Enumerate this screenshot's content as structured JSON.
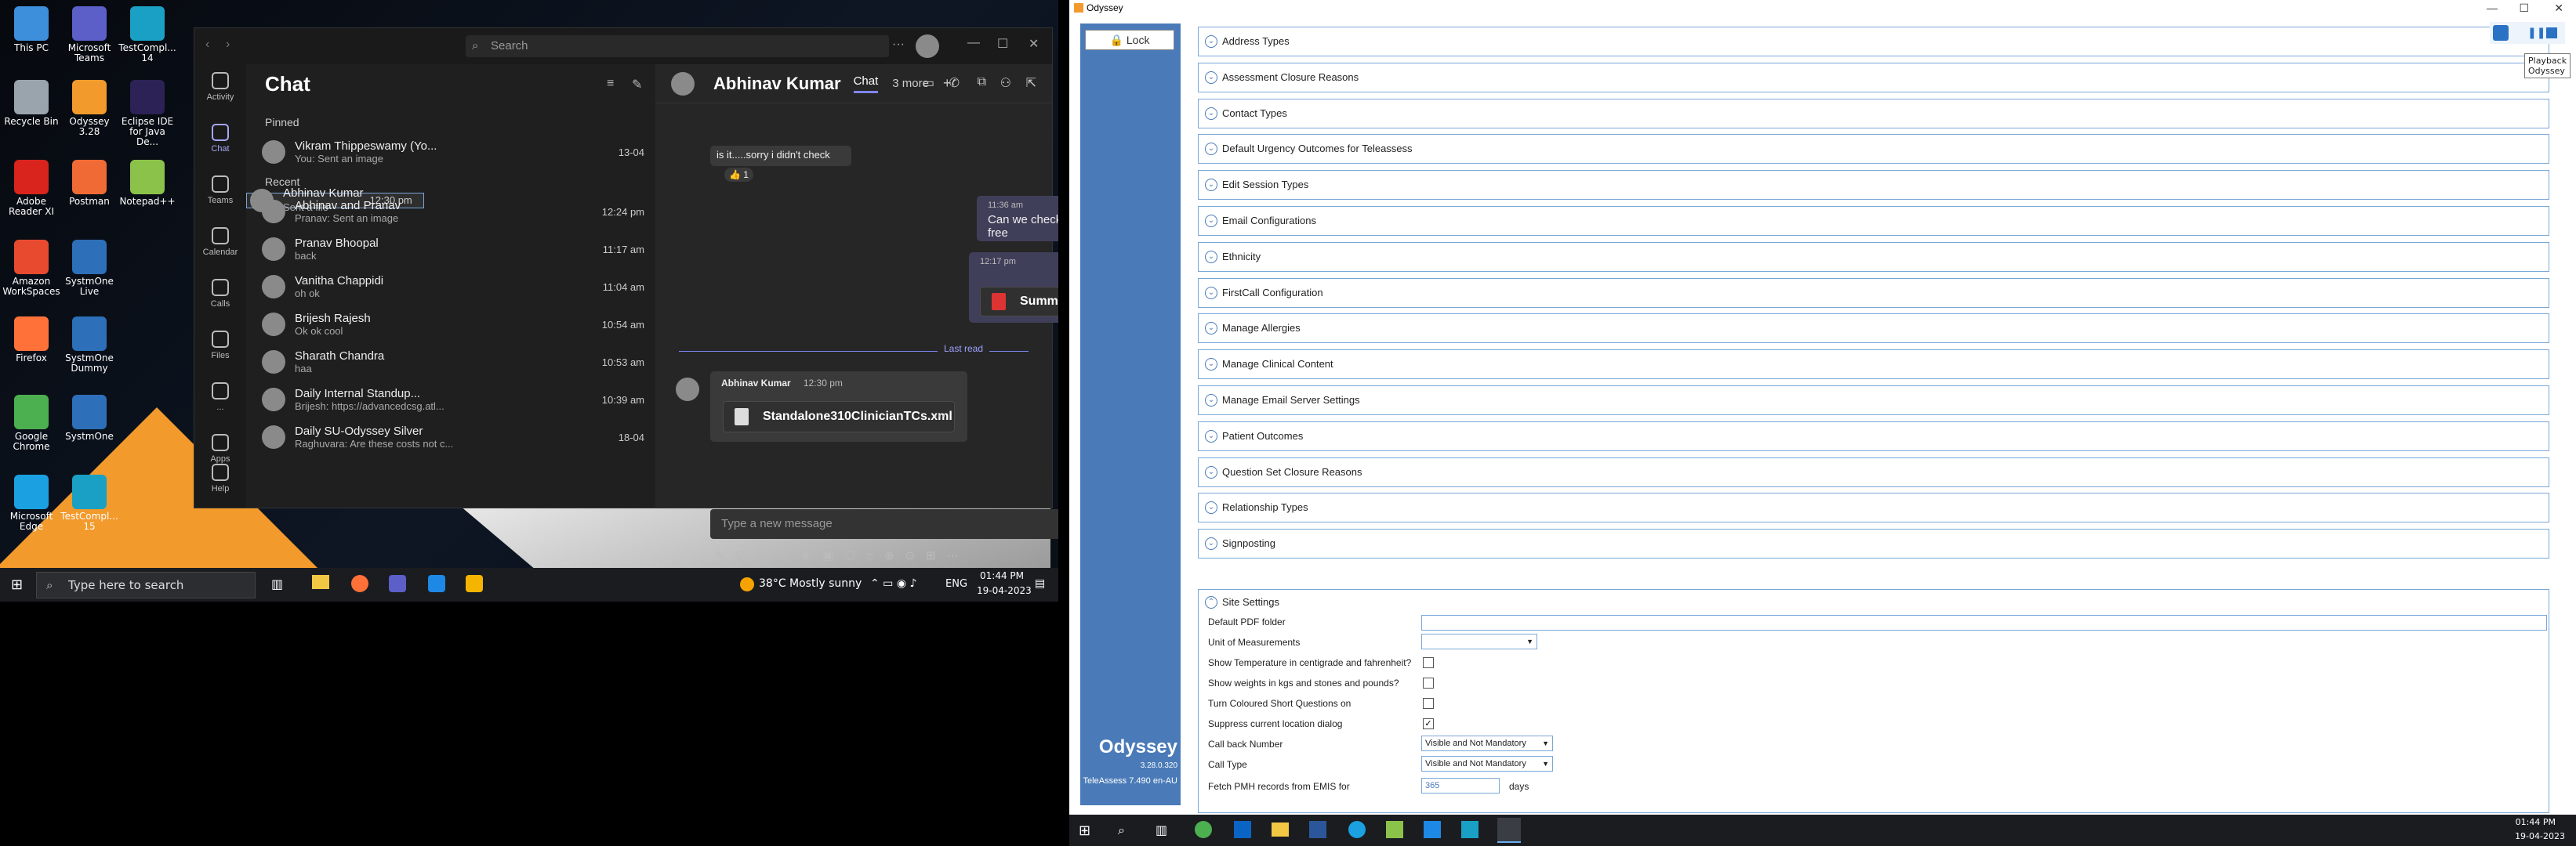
{
  "desktop": {
    "icons": [
      {
        "label": "This PC",
        "color": "#3d8edb"
      },
      {
        "label": "Microsoft Teams",
        "color": "#5b5fc7"
      },
      {
        "label": "TestCompl... 14",
        "color": "#1aa0c4"
      },
      {
        "label": "Recycle Bin",
        "color": "#9aa4ad"
      },
      {
        "label": "Odyssey 3.28",
        "color": "#f29a2c"
      },
      {
        "label": "Eclipse IDE for Java De...",
        "color": "#2c2255"
      },
      {
        "label": "Adobe Reader XI",
        "color": "#d8241c"
      },
      {
        "label": "Postman",
        "color": "#f06a35"
      },
      {
        "label": "Notepad++",
        "color": "#8bc34a"
      },
      {
        "label": "Amazon WorkSpaces",
        "color": "#e84a2f"
      },
      {
        "label": "SystmOne Live",
        "color": "#2d6fb8"
      },
      {
        "label": "Firefox",
        "color": "#ff7139"
      },
      {
        "label": "SystmOne Dummy",
        "color": "#2d6fb8"
      },
      {
        "label": "Google Chrome",
        "color": "#4caf50"
      },
      {
        "label": "SystmOne",
        "color": "#2d6fb8"
      },
      {
        "label": "Microsoft Edge",
        "color": "#1ba1e2"
      },
      {
        "label": "TestCompl... 15",
        "color": "#1aa0c4"
      }
    ]
  },
  "teams": {
    "search_placeholder": "Search",
    "rail": [
      {
        "label": "Activity"
      },
      {
        "label": "Chat"
      },
      {
        "label": "Teams"
      },
      {
        "label": "Calendar"
      },
      {
        "label": "Calls"
      },
      {
        "label": "Files"
      },
      {
        "label": "..."
      },
      {
        "label": "Apps"
      },
      {
        "label": "Help"
      }
    ],
    "list_title": "Chat",
    "pinned_label": "Pinned",
    "recent_label": "Recent",
    "pinned": [
      {
        "name": "Vikram Thippeswamy (Yo...",
        "preview": "You: Sent an image",
        "time": "13-04"
      }
    ],
    "recent": [
      {
        "name": "Abhinav Kumar",
        "preview": "Sent a file",
        "time": "12:30 pm"
      },
      {
        "name": "Abhinav and Pranav",
        "preview": "Pranav: Sent an image",
        "time": "12:24 pm"
      },
      {
        "name": "Pranav Bhoopal",
        "preview": "back",
        "time": "11:17 am"
      },
      {
        "name": "Vanitha Chappidi",
        "preview": "oh ok",
        "time": "11:04 am"
      },
      {
        "name": "Brijesh Rajesh",
        "preview": "Ok ok cool",
        "time": "10:54 am"
      },
      {
        "name": "Sharath Chandra",
        "preview": "haa",
        "time": "10:53 am"
      },
      {
        "name": "Daily Internal Standup...",
        "preview": "Brijesh: https://advancedcsg.atl...",
        "time": "10:39 am"
      },
      {
        "name": "Daily SU-Odyssey Silver",
        "preview": "Raghuvara: Are these costs not c...",
        "time": "18-04"
      }
    ],
    "header": {
      "name": "Abhinav Kumar",
      "tab_chat": "Chat",
      "tab_more": "3 more"
    },
    "messages": {
      "m1": "is it.....sorry i didn't check",
      "m1_react": "👍 1",
      "m2_time": "11:36 am",
      "m2": "Can we check automation, when ua free",
      "m3_time": "12:17 pm",
      "m3_file": "Summary for FC.pdf",
      "last_read": "Last read",
      "m4_author": "Abhinav Kumar",
      "m4_time": "12:30 pm",
      "m4_file": "Standalone310ClinicianTCs.xml"
    },
    "compose_placeholder": "Type a new message"
  },
  "taskbar1": {
    "search": "Type here to search",
    "weather": "38°C  Mostly sunny",
    "lang": "ENG",
    "time": "01:44 PM",
    "date": "19-04-2023"
  },
  "odyssey": {
    "title": "Odyssey",
    "lock": "Lock",
    "brand": "Odyssey",
    "version": "3.28.0.320",
    "ta": "TeleAssess 7.490 en-AU",
    "tooltip_line1": "Playback",
    "tooltip_line2": "Odyssey",
    "sections": [
      "Address Types",
      "Assessment Closure Reasons",
      "Contact Types",
      "Default Urgency Outcomes for Teleassess",
      "Edit Session Types",
      "Email Configurations",
      "Ethnicity",
      "FirstCall Configuration",
      "Manage Allergies",
      "Manage Clinical Content",
      "Manage Email Server Settings",
      "Patient Outcomes",
      "Question Set Closure Reasons",
      "Relationship Types",
      "Signposting"
    ],
    "site": {
      "title": "Site Settings",
      "pdf_label": "Default PDF folder",
      "uom_label": "Unit of Measurements",
      "temp_label": "Show Temperature in centigrade and fahrenheit?",
      "weights_label": "Show weights in kgs and stones and pounds?",
      "coloured_label": "Turn Coloured Short Questions on",
      "suppress_label": "Suppress current location dialog",
      "suppress_checked": true,
      "callback_label": "Call back Number",
      "callback_value": "Visible and Not Mandatory",
      "calltype_label": "Call Type",
      "calltype_value": "Visible and Not Mandatory",
      "fetch_label": "Fetch PMH records from EMIS for",
      "fetch_value": "365",
      "fetch_unit": "days"
    }
  },
  "taskbar2": {
    "time": "01:44 PM",
    "date": "19-04-2023"
  }
}
